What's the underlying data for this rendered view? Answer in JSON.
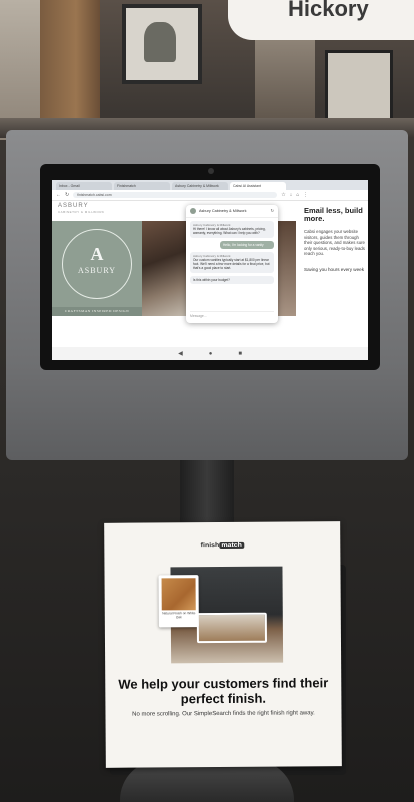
{
  "background": {
    "sign_text": "Hickory"
  },
  "browser": {
    "tabs": [
      {
        "label": "Inbox - Gmail"
      },
      {
        "label": "Finishmatch"
      },
      {
        "label": "Asbury Cabinetry & Millwork"
      },
      {
        "label": "Cabsi AI Assistant"
      }
    ],
    "url": "finishmatch.cabsi.com",
    "nav_icons": [
      "back-icon",
      "reload-icon"
    ],
    "right_icons": [
      "star-icon",
      "download-icon",
      "home-icon",
      "menu-icon"
    ]
  },
  "site": {
    "brand_header": "ASBURY",
    "brand_subheader": "CABINETRY & MILLWORK",
    "seal_letter": "A",
    "seal_text": "ASBURY",
    "hero_footer": "CRAFTSMAN INSPIRED DESIGN"
  },
  "chat": {
    "title": "Asbury Cabinetry & Millwork",
    "messages": [
      {
        "who": "Asbury Cabinetry & Millwork",
        "text": "Hi there! I know all about Asbury's cabinets, pricing, warranty, everything. What can I help you with?",
        "from": "bot"
      },
      {
        "who": "",
        "text": "Hello, I'm looking for a vanity",
        "from": "user"
      },
      {
        "who": "Asbury Cabinetry & Millwork",
        "text": "Our custom vanities typically start at $1,800 per linear foot. We'll need a few more details for a final price, but that's a good place to start.",
        "from": "bot"
      },
      {
        "who": "",
        "text": "Is this within your budget?",
        "from": "bot"
      }
    ],
    "input_placeholder": "Message..."
  },
  "promo": {
    "heading": "Email less, build more.",
    "body": "Cabsi engages your website visitors, guides them through their questions, and makes sure only serious, ready-to-buy leads reach you.",
    "tagline": "Saving you hours every week"
  },
  "android_nav": [
    "◀",
    "●",
    "■"
  ],
  "flyer": {
    "logo_prefix": "finish",
    "logo_highlight": "match",
    "swatch_label": "Natural Finish on White Oak",
    "headline": "We help your customers find their perfect finish.",
    "subtext": "No more scrolling. Our SimpleSearch finds the right finish right away."
  }
}
